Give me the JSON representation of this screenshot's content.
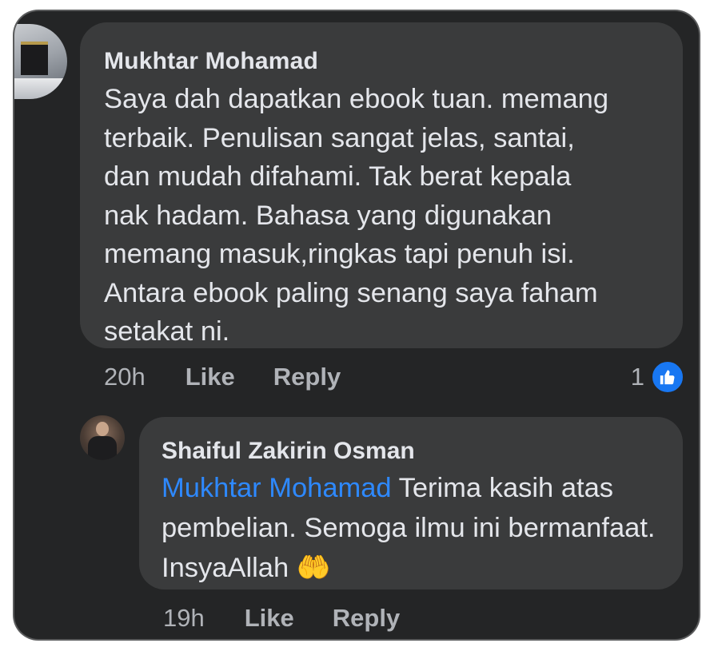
{
  "comment": {
    "author": "Mukhtar Mohamad",
    "text": "Saya dah dapatkan ebook tuan. memang\nterbaik. Penulisan sangat jelas, santai,\ndan mudah difahami. Tak berat kepala\nnak hadam. Bahasa yang digunakan\nmemang masuk,ringkas tapi penuh isi.\nAntara ebook paling senang saya faham\nsetakat ni.",
    "time": "20h",
    "like_label": "Like",
    "reply_label": "Reply",
    "reaction_count": "1",
    "reaction_icon": "thumbs-up-icon"
  },
  "reply": {
    "author": "Shaiful Zakirin Osman",
    "mention": "Mukhtar Mohamad",
    "text": " Terima kasih atas pembelian. Semoga ilmu ini bermanfaat. InsyaAllah ",
    "emoji": "🤲",
    "time": "19h",
    "like_label": "Like",
    "reply_label": "Reply"
  },
  "colors": {
    "background": "#242526",
    "bubble": "#3a3b3c",
    "text": "#e4e6eb",
    "muted": "#b0b3b8",
    "accent": "#1877f2",
    "mention": "#2e89ff"
  }
}
